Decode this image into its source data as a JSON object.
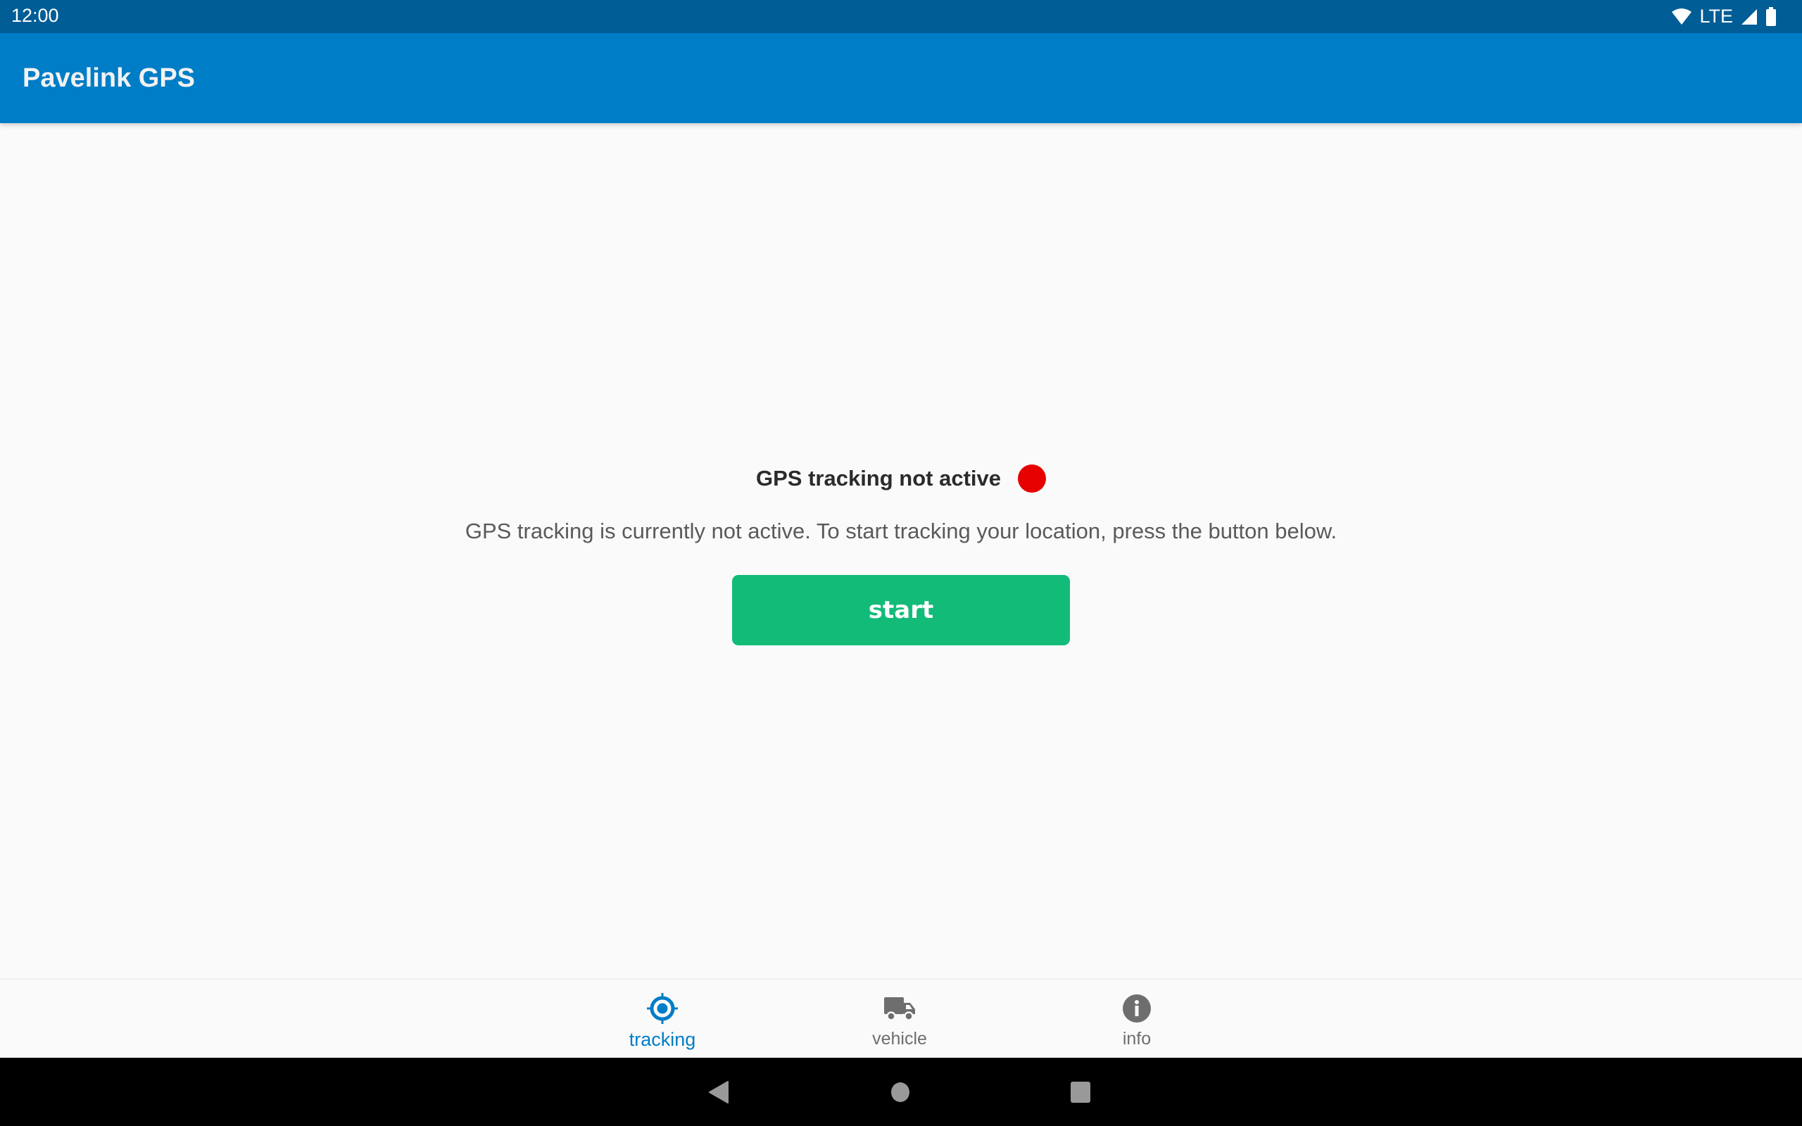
{
  "status_bar": {
    "time": "12:00",
    "network": "LTE",
    "icons": [
      "wifi-icon",
      "signal-icon",
      "battery-icon"
    ]
  },
  "app_bar": {
    "title": "Pavelink GPS"
  },
  "main": {
    "status_title": "GPS tracking not active",
    "status_color": "#e60000",
    "description": "GPS tracking is currently not active. To start tracking your location, press the button below.",
    "start_button": "start",
    "start_button_color": "#13bb79"
  },
  "bottom_nav": {
    "tabs": [
      {
        "label": "tracking",
        "icon": "crosshair-icon",
        "active": true
      },
      {
        "label": "vehicle",
        "icon": "truck-icon",
        "active": false
      },
      {
        "label": "info",
        "icon": "info-icon",
        "active": false
      }
    ]
  },
  "system_nav": {
    "buttons": [
      "back",
      "home",
      "recents"
    ]
  }
}
